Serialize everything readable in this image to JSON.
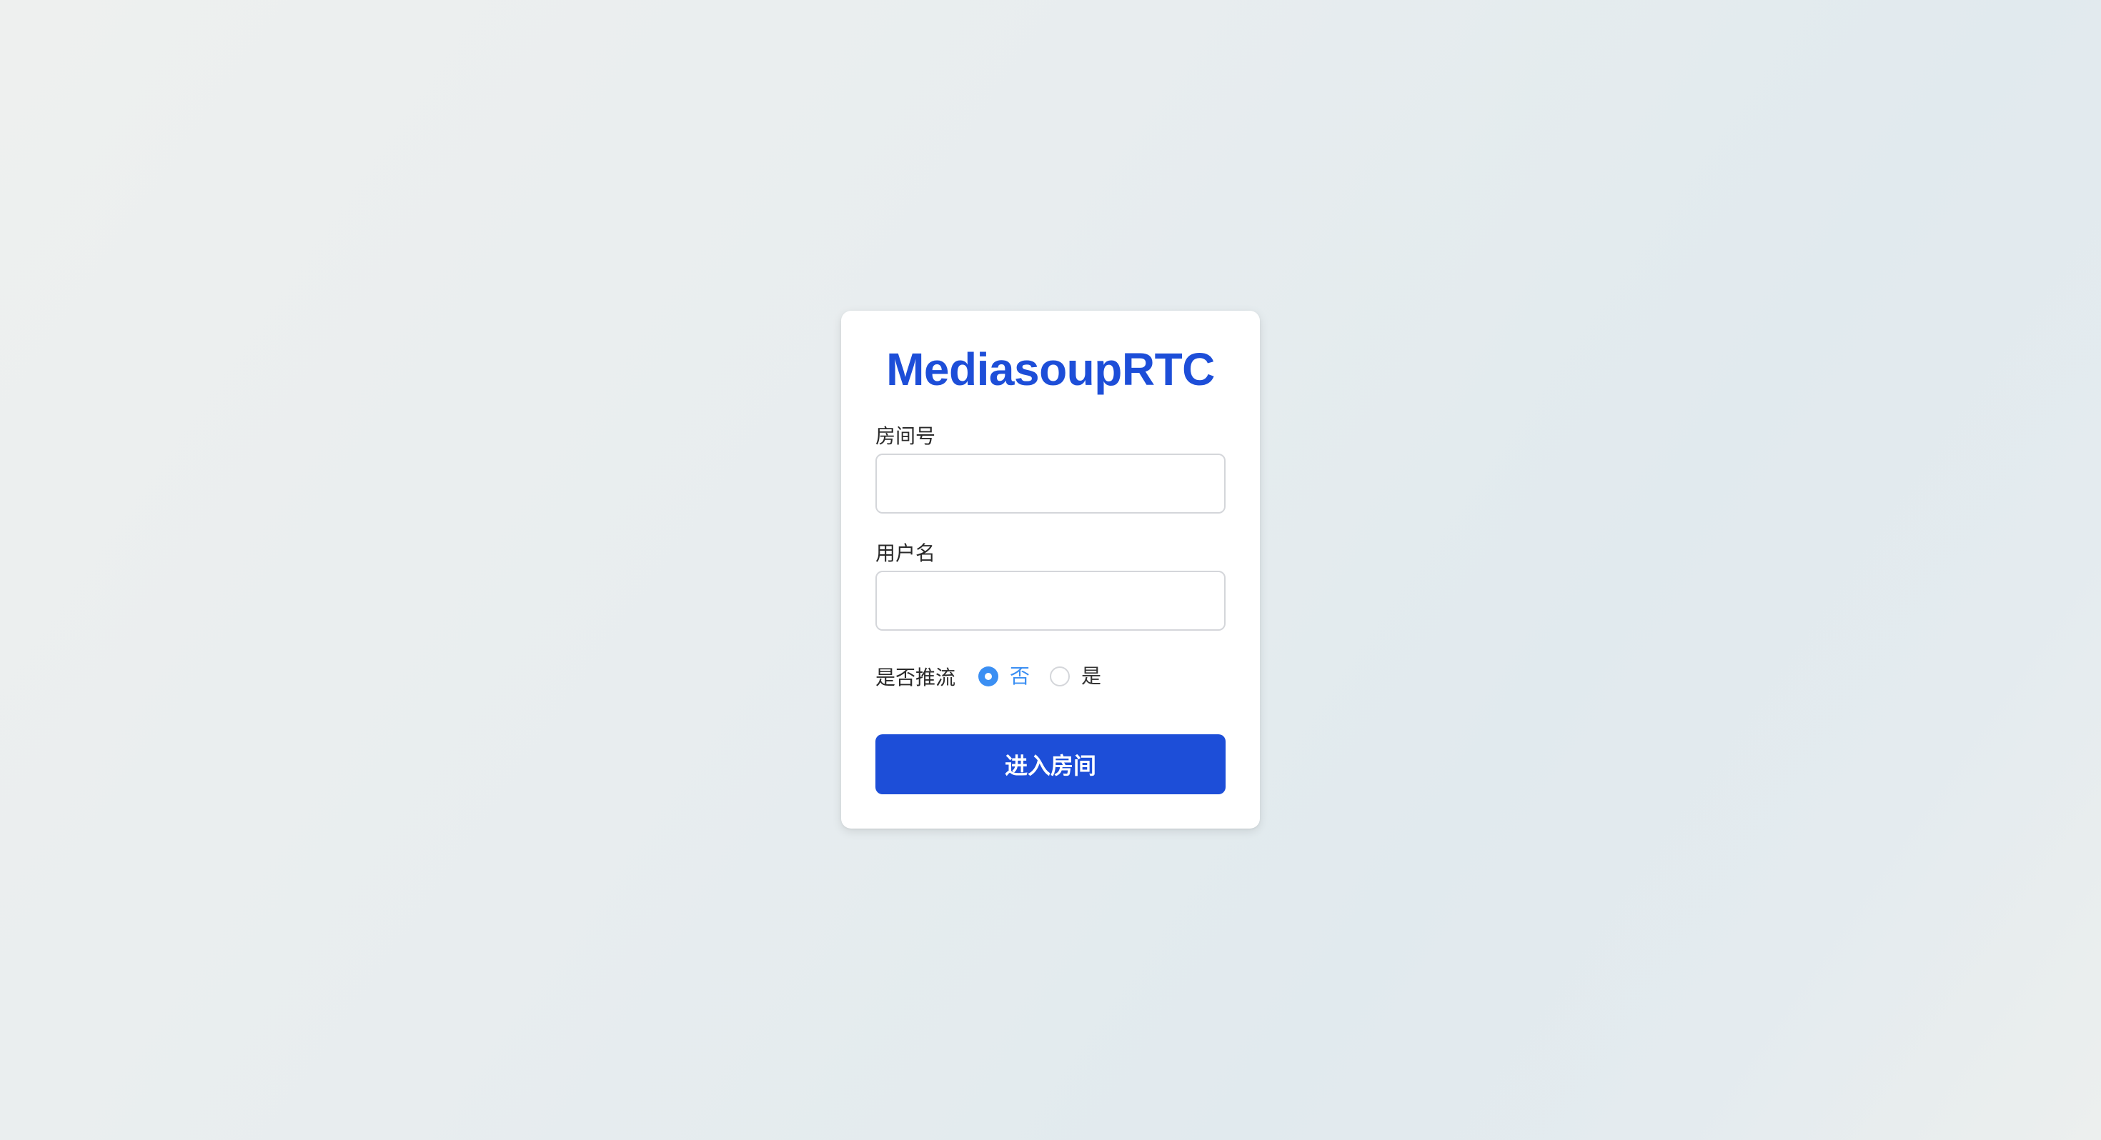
{
  "card": {
    "title": "MediasoupRTC"
  },
  "form": {
    "room_label": "房间号",
    "room_value": "",
    "username_label": "用户名",
    "username_value": "",
    "publish_label": "是否推流",
    "publish_options": [
      {
        "label": "否",
        "checked": true
      },
      {
        "label": "是",
        "checked": false
      }
    ],
    "submit_label": "进入房间"
  },
  "colors": {
    "brand": "#1d4ed8",
    "radio_accent": "#3b8ff3",
    "card_background": "#ffffff"
  }
}
